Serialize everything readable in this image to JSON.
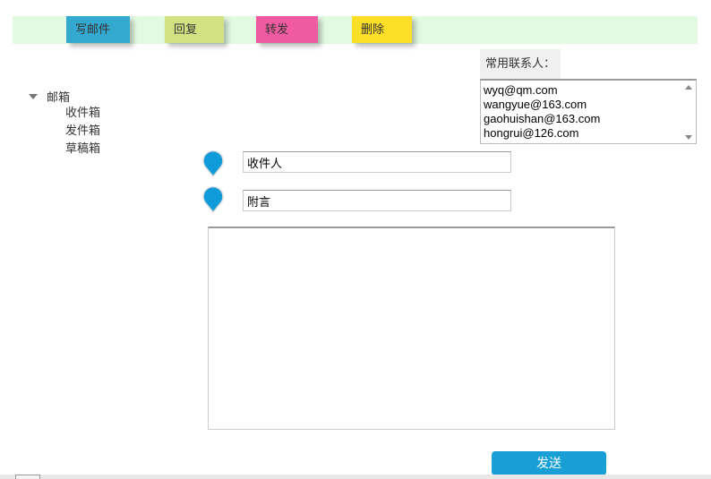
{
  "toolbar": {
    "buttons": [
      {
        "label": "写邮件",
        "color": "#33a9d0"
      },
      {
        "label": "回复",
        "color": "#d2e283"
      },
      {
        "label": "转发",
        "color": "#f05aa0"
      },
      {
        "label": "删除",
        "color": "#fddf27"
      }
    ]
  },
  "contacts": {
    "label": "常用联系人：",
    "items": [
      "wyq@qm.com",
      "wangyue@163.com",
      "gaohuishan@163.com",
      "hongrui@126.com"
    ]
  },
  "tree": {
    "root": "邮箱",
    "children": [
      "收件箱",
      "发件箱",
      "草稿箱"
    ]
  },
  "form": {
    "recipient_value": "收件人",
    "note_value": "附言",
    "body_value": "",
    "send_label": "发送",
    "pin_color": "#0e9bd8"
  }
}
